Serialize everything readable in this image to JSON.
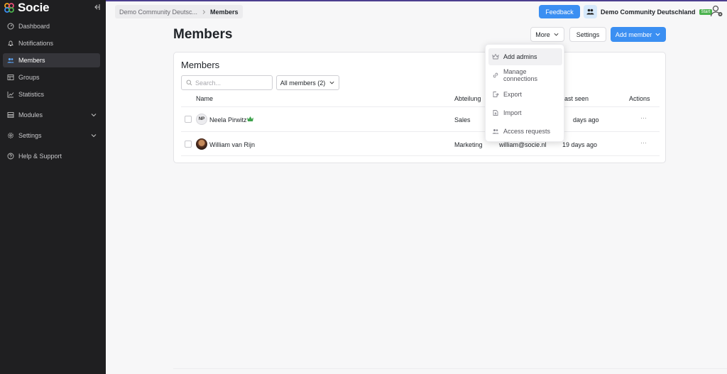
{
  "app": {
    "name": "Socie"
  },
  "sidebar": {
    "items": [
      {
        "label": "Dashboard",
        "icon": "dashboard-icon"
      },
      {
        "label": "Notifications",
        "icon": "bell-icon"
      },
      {
        "label": "Members",
        "icon": "users-icon",
        "active": true
      },
      {
        "label": "Groups",
        "icon": "groups-icon"
      },
      {
        "label": "Statistics",
        "icon": "chart-icon"
      },
      {
        "label": "Modules",
        "icon": "modules-icon",
        "expandable": true
      },
      {
        "label": "Settings",
        "icon": "gear-icon",
        "expandable": true
      },
      {
        "label": "Help & Support",
        "icon": "help-icon"
      }
    ]
  },
  "topbar": {
    "breadcrumb": {
      "parent": "Demo Community Deutsc...",
      "current": "Members"
    },
    "feedback_label": "Feedback",
    "community": {
      "name": "Demo Community Deutschland",
      "badge": "Start"
    }
  },
  "page": {
    "title": "Members",
    "more_label": "More",
    "settings_label": "Settings",
    "add_member_label": "Add member"
  },
  "card": {
    "title": "Members",
    "search_placeholder": "Search...",
    "filter_label": "All members (2)",
    "columns": {
      "name": "Name",
      "abteilung": "Abteilung",
      "last_seen": "ast seen",
      "actions": "Actions"
    },
    "rows": [
      {
        "initials": "NP",
        "name": "Neela Pirwitz",
        "admin": true,
        "abteilung": "Sales",
        "email": "",
        "last_seen": "days ago",
        "actions": "···"
      },
      {
        "initials": "",
        "name": "William van Rijn",
        "admin": false,
        "abteilung": "Marketing",
        "email": "william@socie.nl",
        "last_seen": "19 days ago",
        "actions": "···"
      }
    ]
  },
  "more_menu": {
    "items": [
      {
        "label": "Add admins",
        "icon": "crown-icon",
        "highlighted": true
      },
      {
        "label": "Manage connections",
        "icon": "link-icon"
      },
      {
        "label": "Export",
        "icon": "export-icon"
      },
      {
        "label": "Import",
        "icon": "import-icon"
      },
      {
        "label": "Access requests",
        "icon": "users-icon"
      }
    ]
  },
  "colors": {
    "accent": "#3b8ff2",
    "sidebar_bg": "#1f1f21",
    "badge_green": "#4cb34f",
    "admin_crown": "#3fa34d"
  }
}
